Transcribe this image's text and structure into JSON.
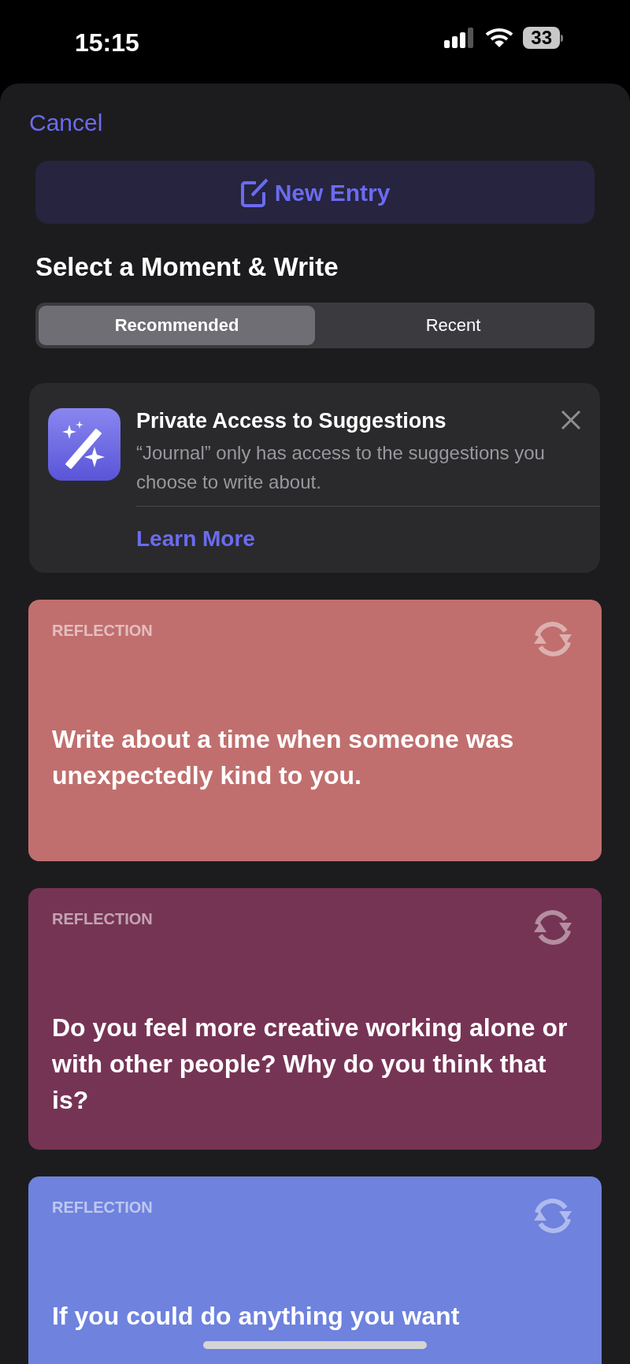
{
  "status_bar": {
    "time": "15:15",
    "battery": "33"
  },
  "cancel": "Cancel",
  "new_entry": "New Entry",
  "heading": "Select a Moment & Write",
  "tabs": [
    {
      "label": "Recommended",
      "selected": true
    },
    {
      "label": "Recent",
      "selected": false
    }
  ],
  "notice": {
    "title": "Private Access to Suggestions",
    "body": "“Journal” only has access to the suggestions you choose to write about.",
    "link": "Learn More"
  },
  "prompts": [
    {
      "category": "REFLECTION",
      "text": "Write about a time when someone was unexpectedly kind to you.",
      "color": "#c06f6e"
    },
    {
      "category": "REFLECTION",
      "text": "Do you feel more creative working alone or with other people? Why do you think that is?",
      "color": "#763455"
    },
    {
      "category": "REFLECTION",
      "text": "If you could do anything you want",
      "color": "#6e82de"
    }
  ]
}
